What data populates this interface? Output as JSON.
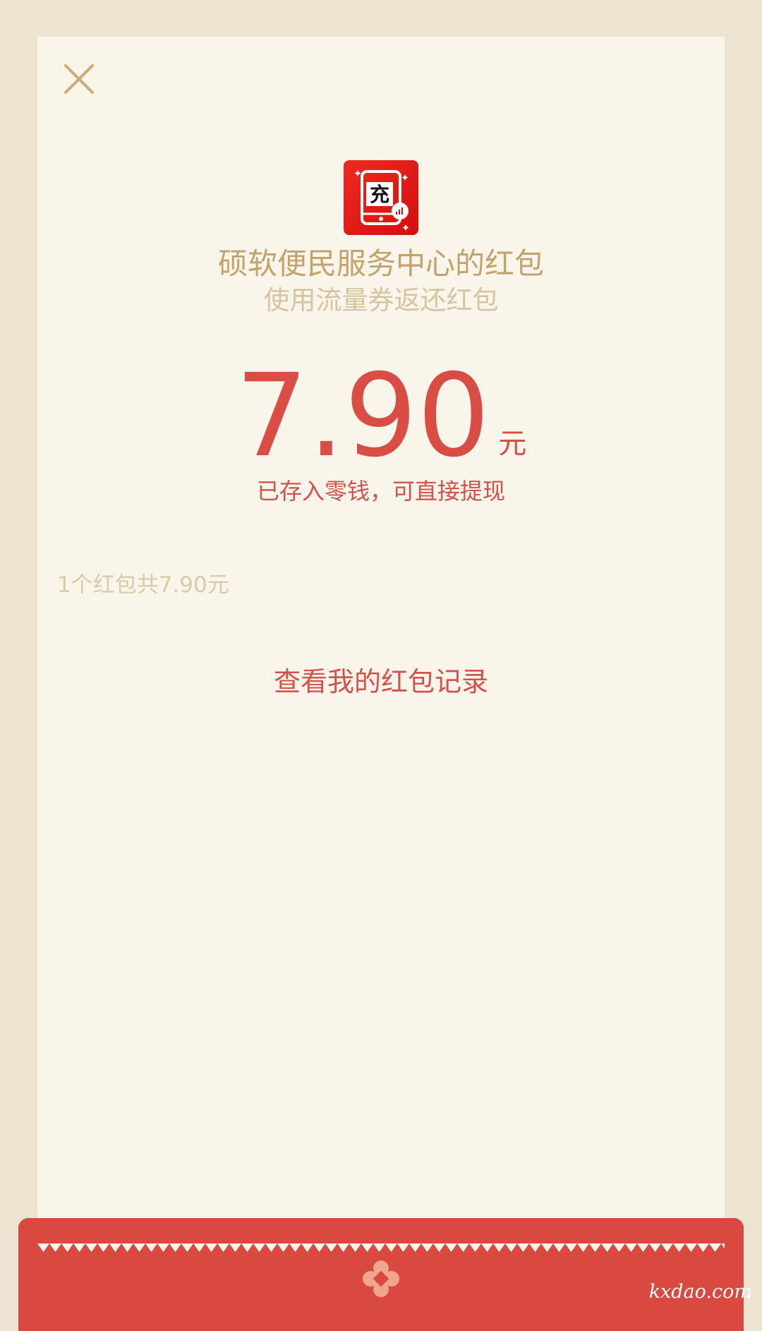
{
  "header": {
    "close_icon": "close-icon"
  },
  "sender": {
    "avatar_icon": "recharge-app-logo-icon",
    "name": "硕软便民服务中心的红包",
    "greeting": "使用流量券返还红包"
  },
  "amount": {
    "value": "7.90",
    "unit": "元",
    "note": "已存入零钱，可直接提现"
  },
  "summary": {
    "text": "1个红包共7.90元"
  },
  "actions": {
    "records_link": "查看我的红包记录"
  },
  "footer": {
    "emblem_icon": "red-packet-emblem-icon",
    "watermark": "kxdao.com"
  },
  "colors": {
    "background": "#ede3d1",
    "paper": "#f9f5ea",
    "gold": "#c2a36b",
    "red": "#d94d44"
  }
}
